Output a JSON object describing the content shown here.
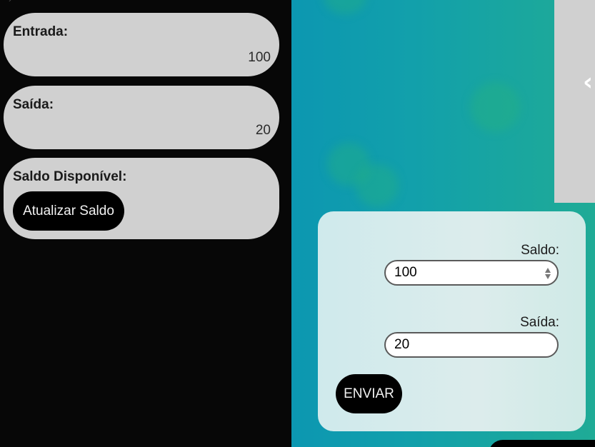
{
  "left": {
    "cards": [
      {
        "label": "Entrada:",
        "value": "100"
      },
      {
        "label": "Saída:",
        "value": "20"
      },
      {
        "label": "Saldo Disponível:",
        "value": ""
      }
    ],
    "update_button_label": "Atualizar Saldo"
  },
  "form": {
    "saldo_label": "Saldo:",
    "saldo_value": "100",
    "saida_label": "Saída:",
    "saida_value": "20",
    "submit_label": "ENVIAR"
  },
  "icons": {
    "next": "chevron-left-icon"
  },
  "colors": {
    "card_bg": "#d0d0d0",
    "button_bg": "#000000",
    "accent_gradient_start": "#0c97b1",
    "accent_gradient_end": "#1fab96",
    "form_bg": "#d8ecec"
  }
}
